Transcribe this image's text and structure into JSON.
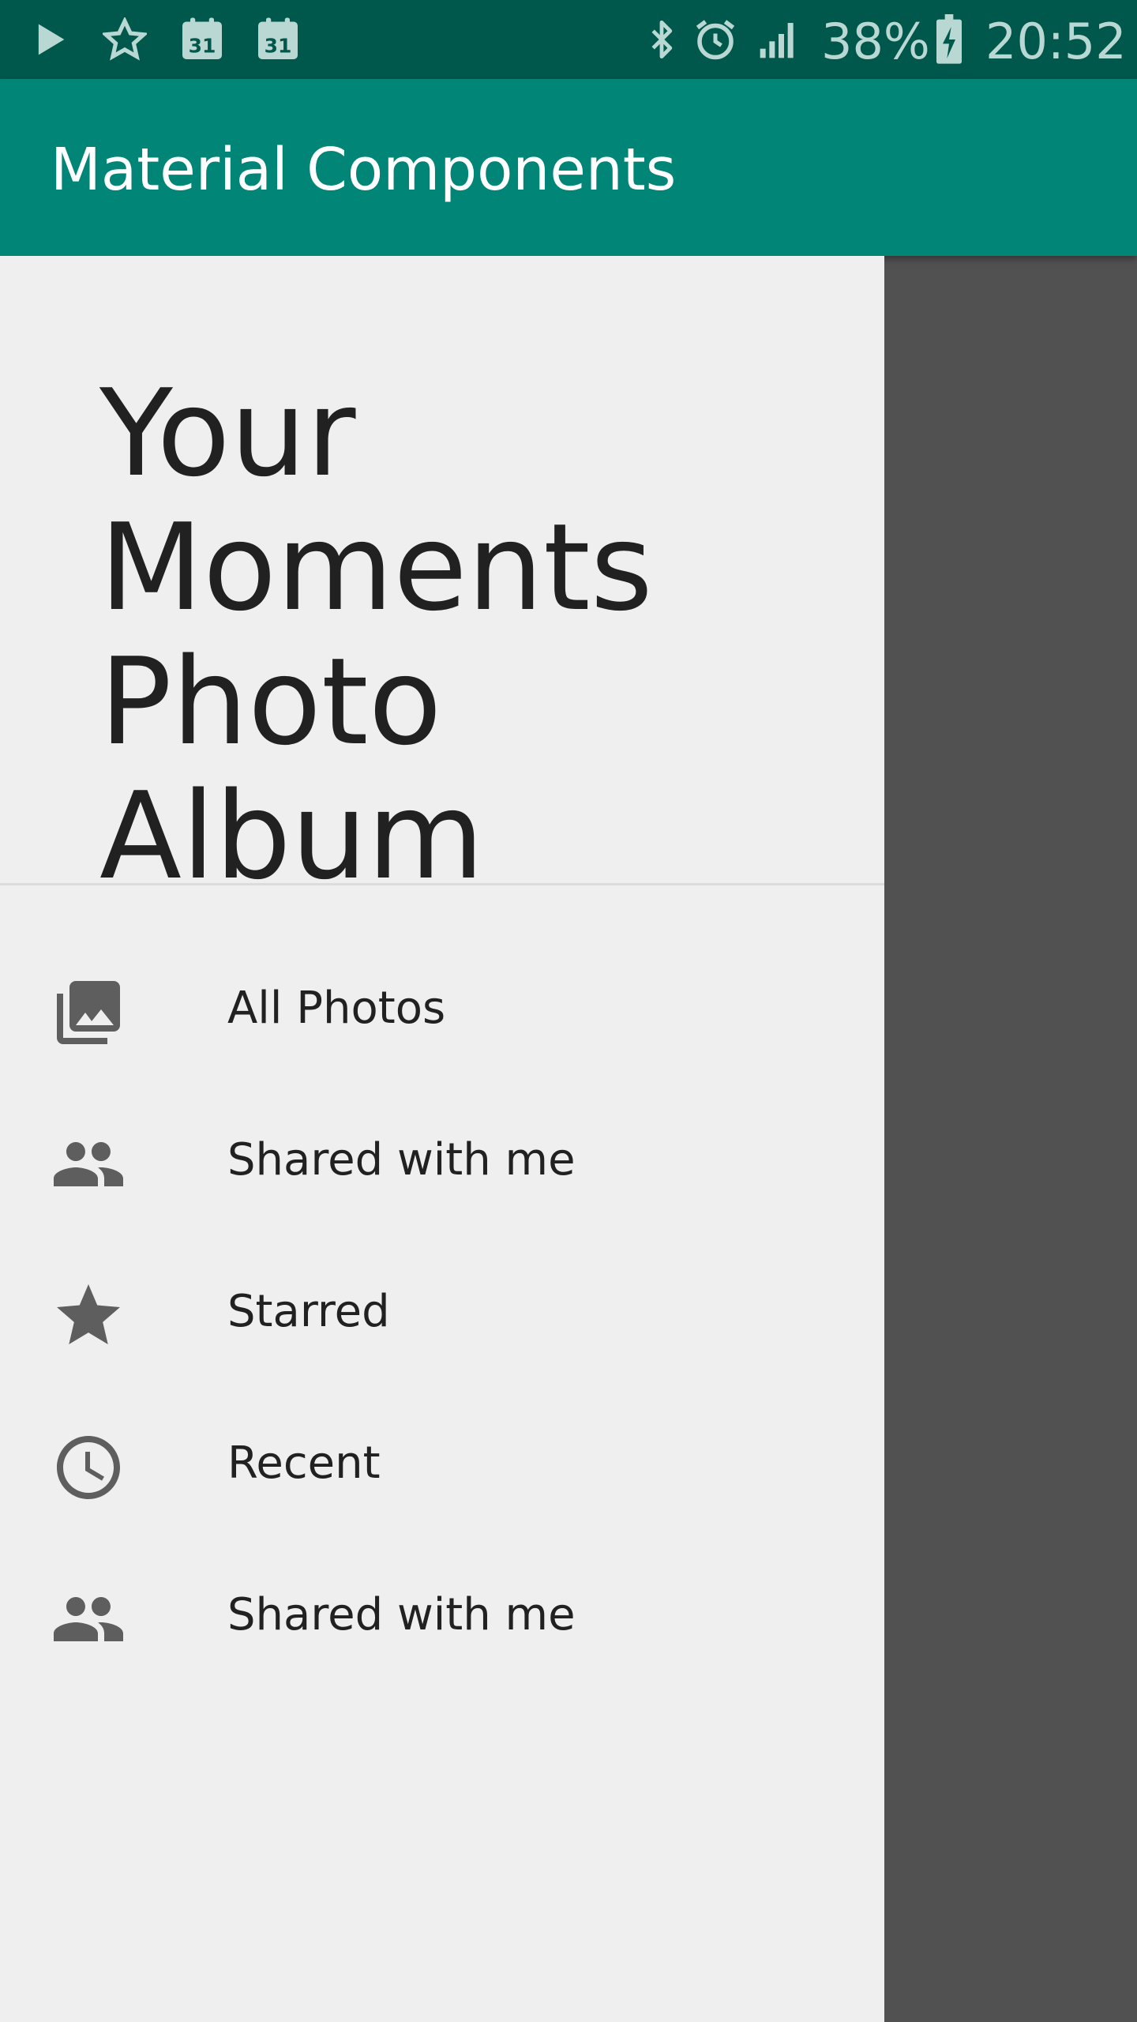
{
  "status_bar": {
    "battery_text": "38%",
    "time": "20:52",
    "calendar_day_1": "31",
    "calendar_day_2": "31",
    "icons": [
      "play-icon",
      "star-outline-icon",
      "calendar-icon",
      "calendar-icon",
      "bluetooth-icon",
      "alarm-icon",
      "signal-icon",
      "battery-charging-icon"
    ]
  },
  "app_bar": {
    "title": "Material Components"
  },
  "drawer": {
    "header_title": "Your Moments Photo Album",
    "items": [
      {
        "label": "All Photos",
        "icon": "photo-library-icon"
      },
      {
        "label": "Shared with me",
        "icon": "people-icon"
      },
      {
        "label": "Starred",
        "icon": "star-icon"
      },
      {
        "label": "Recent",
        "icon": "clock-icon"
      },
      {
        "label": "Shared with me",
        "icon": "people-icon"
      }
    ]
  },
  "colors": {
    "status_bar": "#00574b",
    "app_bar": "#008577",
    "drawer_background": "#efefef",
    "scrim": "#515151",
    "icon": "#5e5e5e",
    "text": "#212121"
  }
}
